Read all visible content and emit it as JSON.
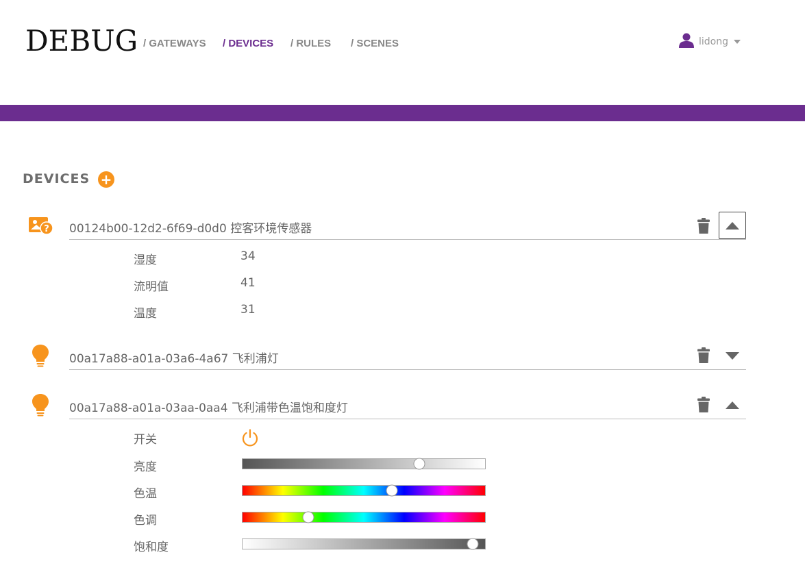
{
  "app": {
    "logo": "DEBUG"
  },
  "nav": [
    {
      "label": "/ GATEWAYS",
      "active": false
    },
    {
      "label": "/ DEVICES",
      "active": true
    },
    {
      "label": "/  RULES",
      "active": false
    },
    {
      "label": "/  SCENES",
      "active": false
    }
  ],
  "user": {
    "name": "lidong",
    "icon": "user-icon"
  },
  "colors": {
    "brand": "#6b2d8f",
    "accent": "#f7941d"
  },
  "devices_section": {
    "title": "DEVICES",
    "add_icon": "plus-icon"
  },
  "devices": [
    {
      "id": "00124b00-12d2-6f69-d0d0",
      "name": "控客环境传感器",
      "title": "00124b00-12d2-6f69-d0d0 控客环境传感器",
      "icon": "sensor-unknown-icon",
      "expanded": true,
      "properties": [
        {
          "label": "湿度",
          "value": "34"
        },
        {
          "label": "流明值",
          "value": "41"
        },
        {
          "label": "温度",
          "value": "31"
        }
      ]
    },
    {
      "id": "00a17a88-a01a-03a6-4a67",
      "name": "飞利浦灯",
      "title": "00a17a88-a01a-03a6-4a67 飞利浦灯",
      "icon": "lightbulb-icon",
      "expanded": false
    },
    {
      "id": "00a17a88-a01a-03aa-0aa4",
      "name": "飞利浦带色温饱和度灯",
      "title": "00a17a88-a01a-03aa-0aa4 飞利浦带色温饱和度灯",
      "icon": "lightbulb-icon",
      "expanded": true,
      "controls": {
        "switch": {
          "label": "开关",
          "icon": "power-icon"
        },
        "brightness": {
          "label": "亮度",
          "level": 0.73
        },
        "color_temperature": {
          "label": "色温",
          "level": 0.615
        },
        "hue": {
          "label": "色调",
          "level": 0.27
        },
        "saturation": {
          "label": "饱和度",
          "level": 0.95
        }
      }
    }
  ]
}
